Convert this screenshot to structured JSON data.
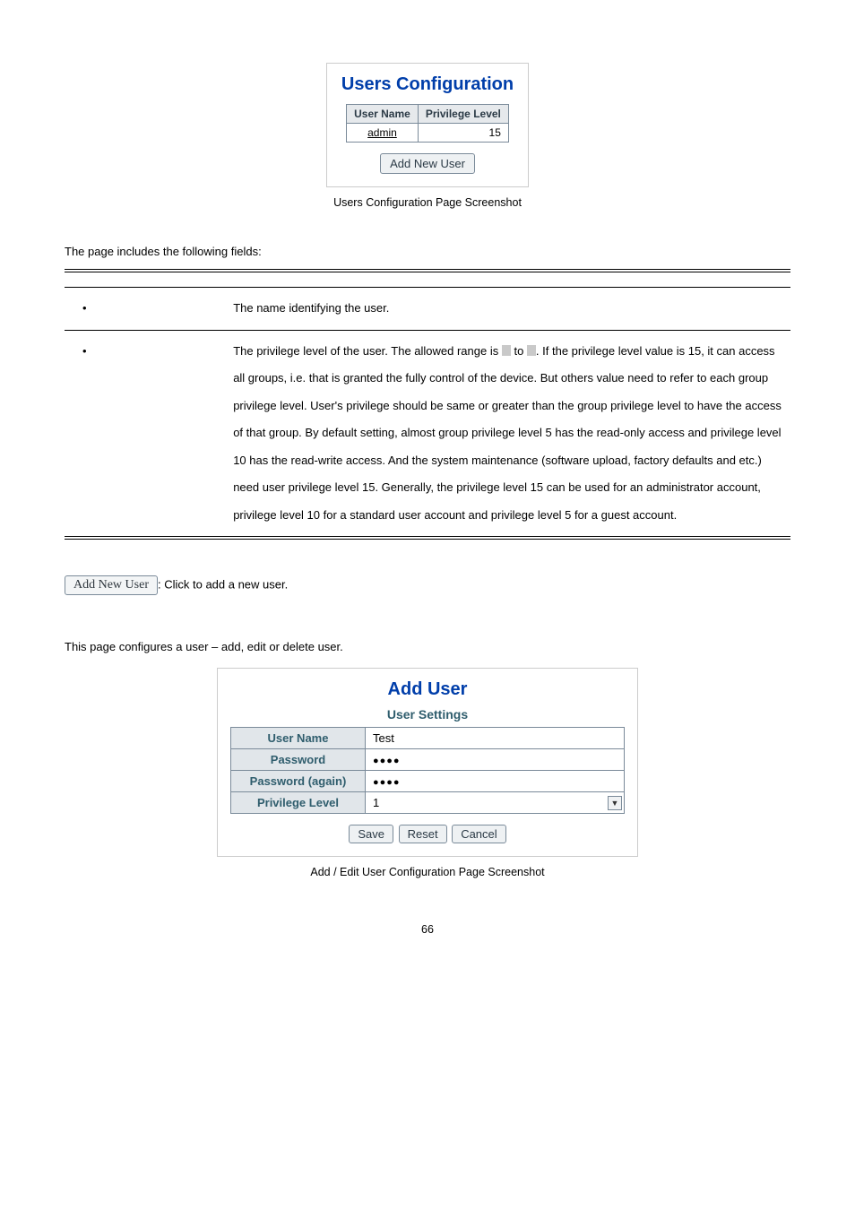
{
  "fig1": {
    "title": "Users Configuration",
    "headers": [
      "User Name",
      "Privilege Level"
    ],
    "rows": [
      {
        "user": "admin",
        "level": "15"
      }
    ],
    "button": "Add New User",
    "caption": "Users Configuration Page Screenshot"
  },
  "intro": "The page includes the following fields:",
  "table": {
    "hdr_object": "",
    "hdr_desc": "",
    "rows": [
      {
        "obj": "",
        "desc": "The name identifying the user."
      },
      {
        "obj": "",
        "desc_before": "The privilege level of the user. The allowed range is ",
        "mid": " to ",
        "desc_after": ". If the privilege level value is 15, it can access all groups, i.e. that is granted the fully control of the device. But others value need to refer to each group privilege level. User's privilege should be same or greater than the group privilege level to have the access of that group. By default setting, almost group privilege level 5 has the read-only access and privilege level 10 has the read-write access. And the system maintenance (software upload, factory defaults and etc.) need user privilege level 15. Generally, the privilege level 15 can be used for an administrator account, privilege level 10 for a standard user account and privilege level 5 for a guest account."
      }
    ]
  },
  "addnew": {
    "button": "Add New User",
    "text": ": Click to add a new user."
  },
  "config_text": "This page configures a user – add, edit or delete user.",
  "fig2": {
    "title": "Add User",
    "subtitle": "User Settings",
    "rows": [
      {
        "label": "User Name",
        "value": "Test",
        "type": "text"
      },
      {
        "label": "Password",
        "value": "●●●●",
        "type": "password"
      },
      {
        "label": "Password (again)",
        "value": "●●●●",
        "type": "password"
      },
      {
        "label": "Privilege Level",
        "value": "1",
        "type": "select"
      }
    ],
    "buttons": [
      "Save",
      "Reset",
      "Cancel"
    ],
    "caption": "Add / Edit User Configuration Page Screenshot"
  },
  "page": "66"
}
